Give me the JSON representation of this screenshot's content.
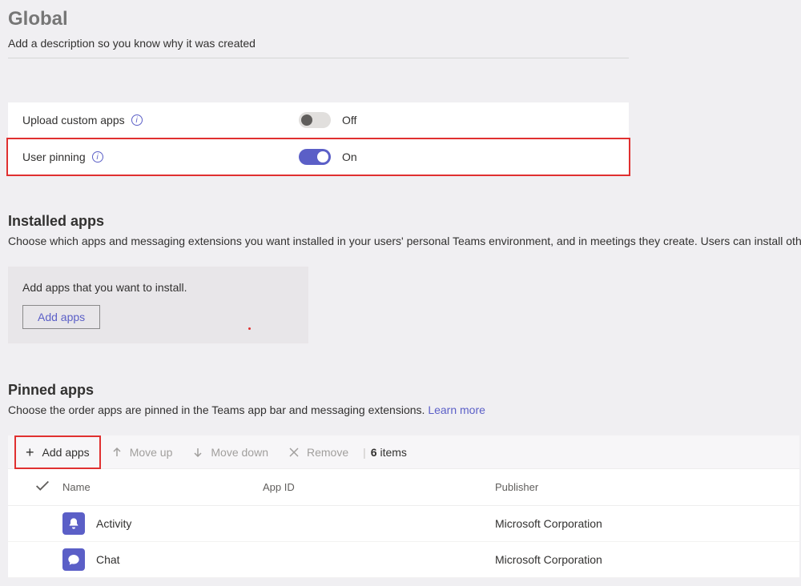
{
  "header": {
    "title": "Global",
    "description": "Add a description so you know why it was created"
  },
  "settings": {
    "upload_custom_apps": {
      "label": "Upload custom apps",
      "state_text": "Off"
    },
    "user_pinning": {
      "label": "User pinning",
      "state_text": "On"
    }
  },
  "installed": {
    "title": "Installed apps",
    "description": "Choose which apps and messaging extensions you want installed in your users' personal Teams environment, and in meetings they create. Users can install other",
    "card_text": "Add apps that you want to install.",
    "add_button": "Add apps"
  },
  "pinned": {
    "title": "Pinned apps",
    "description_prefix": "Choose the order apps are pinned in the Teams app bar and messaging extensions. ",
    "learn_more": "Learn more",
    "toolbar": {
      "add": "Add apps",
      "move_up": "Move up",
      "move_down": "Move down",
      "remove": "Remove",
      "count": "6",
      "items_word": "items"
    },
    "columns": {
      "name": "Name",
      "app_id": "App ID",
      "publisher": "Publisher"
    },
    "rows": [
      {
        "name": "Activity",
        "app_id": "",
        "publisher": "Microsoft Corporation",
        "icon": "bell"
      },
      {
        "name": "Chat",
        "app_id": "",
        "publisher": "Microsoft Corporation",
        "icon": "chat"
      }
    ]
  }
}
